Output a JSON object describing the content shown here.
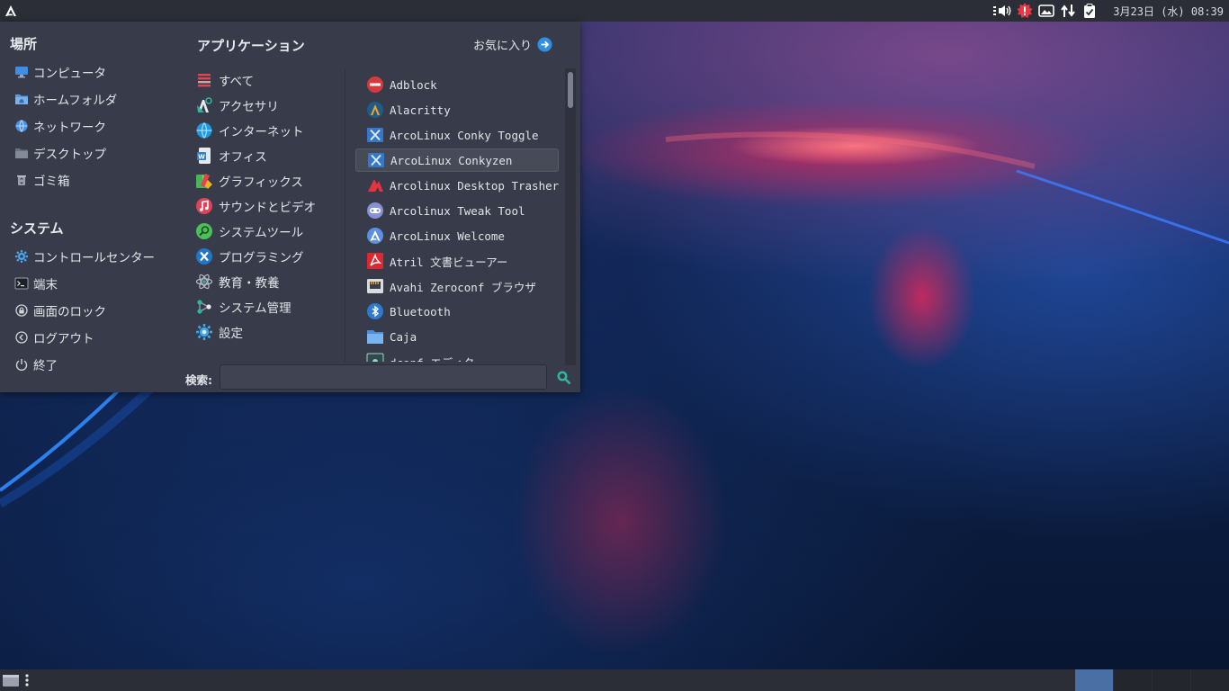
{
  "top_panel": {
    "clock": "3月23日 (水) 08:39",
    "tray_icons": [
      "volume-icon",
      "update-notifier-icon",
      "screenshot-icon",
      "network-icon",
      "clipboard-icon"
    ]
  },
  "menu": {
    "places": {
      "title": "場所",
      "items": [
        {
          "label": "コンピュータ",
          "icon": "computer-icon"
        },
        {
          "label": "ホームフォルダ",
          "icon": "home-folder-icon"
        },
        {
          "label": "ネットワーク",
          "icon": "network-globe-icon"
        },
        {
          "label": "デスクトップ",
          "icon": "desktop-folder-icon"
        },
        {
          "label": "ゴミ箱",
          "icon": "trash-icon"
        }
      ]
    },
    "system": {
      "title": "システム",
      "items": [
        {
          "label": "コントロールセンター",
          "icon": "control-center-icon"
        },
        {
          "label": "端末",
          "icon": "terminal-icon"
        },
        {
          "label": "画面のロック",
          "icon": "lock-screen-icon"
        },
        {
          "label": "ログアウト",
          "icon": "logout-icon"
        },
        {
          "label": "終了",
          "icon": "power-icon"
        }
      ]
    },
    "applications": {
      "title": "アプリケーション",
      "favorites_link": "お気に入り",
      "categories": [
        {
          "label": "すべて",
          "icon": "all-apps-icon"
        },
        {
          "label": "アクセサリ",
          "icon": "accessories-icon"
        },
        {
          "label": "インターネット",
          "icon": "internet-icon"
        },
        {
          "label": "オフィス",
          "icon": "office-icon"
        },
        {
          "label": "グラフィックス",
          "icon": "graphics-icon"
        },
        {
          "label": "サウンドとビデオ",
          "icon": "sound-video-icon"
        },
        {
          "label": "システムツール",
          "icon": "system-tools-icon"
        },
        {
          "label": "プログラミング",
          "icon": "programming-icon"
        },
        {
          "label": "教育・教養",
          "icon": "education-icon"
        },
        {
          "label": "システム管理",
          "icon": "system-admin-icon"
        },
        {
          "label": "設定",
          "icon": "settings-icon"
        }
      ],
      "apps": [
        {
          "label": "Adblock",
          "icon": "adblock-icon"
        },
        {
          "label": "Alacritty",
          "icon": "alacritty-icon"
        },
        {
          "label": "ArcoLinux Conky Toggle",
          "icon": "conky-icon"
        },
        {
          "label": "ArcoLinux Conkyzen",
          "icon": "conky-icon"
        },
        {
          "label": "Arcolinux Desktop Trasher",
          "icon": "desktop-trasher-icon"
        },
        {
          "label": "Arcolinux Tweak Tool",
          "icon": "tweak-tool-icon"
        },
        {
          "label": "ArcoLinux Welcome",
          "icon": "arcolinux-welcome-icon"
        },
        {
          "label": "Atril 文書ビューアー",
          "icon": "atril-pdf-icon"
        },
        {
          "label": "Avahi Zeroconf ブラウザ",
          "icon": "avahi-network-icon"
        },
        {
          "label": "Bluetooth",
          "icon": "bluetooth-icon"
        },
        {
          "label": "Caja",
          "icon": "caja-folder-icon"
        },
        {
          "label": "dconf エディタ",
          "icon": "dconf-editor-icon"
        }
      ],
      "selected_app": "ArcoLinux Conkyzen"
    },
    "search": {
      "label": "検索:",
      "value": "",
      "placeholder": ""
    }
  },
  "colors": {
    "panel_bg": "#2b2e37",
    "menu_bg": "#383c4a",
    "accent_blue": "#2f8ee0",
    "workspace_active": "#4a6fa5"
  }
}
